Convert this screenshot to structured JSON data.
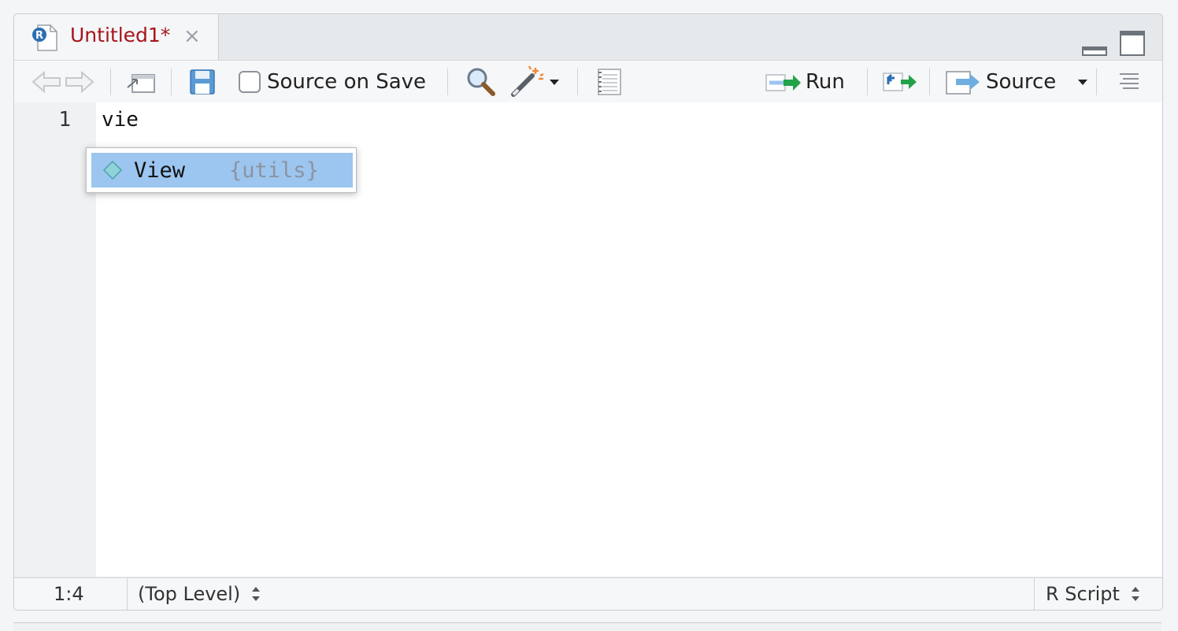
{
  "tab": {
    "title": "Untitled1*",
    "close_glyph": "×",
    "icon": "r-file-icon"
  },
  "toolbar": {
    "source_on_save_label": "Source on Save",
    "source_on_save_checked": false,
    "run_label": "Run",
    "source_label": "Source"
  },
  "editor": {
    "lines": [
      {
        "number": "1",
        "text": "vie"
      }
    ]
  },
  "autocomplete": {
    "items": [
      {
        "name": "View",
        "package": "{utils}",
        "icon": "function-icon"
      }
    ]
  },
  "status": {
    "position": "1:4",
    "scope": "(Top Level)",
    "file_type": "R Script"
  },
  "colors": {
    "tab_title": "#a8141a",
    "selection": "#9cc5ef",
    "run_arrow": "#22a34a"
  }
}
